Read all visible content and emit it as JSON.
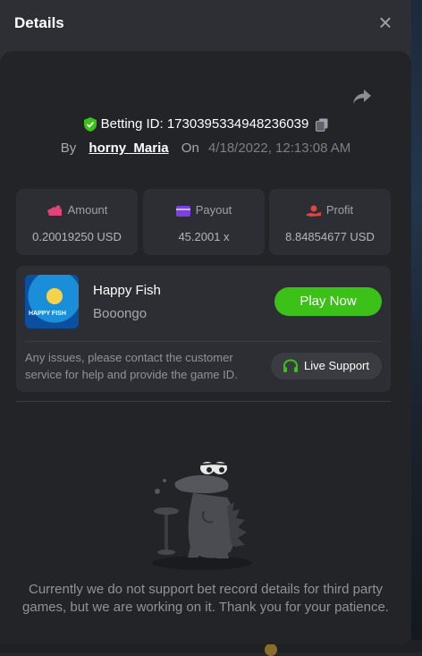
{
  "modal": {
    "title": "Details"
  },
  "bet": {
    "betting_id_label": "Betting ID: 1730395334948236039",
    "by_label": "By",
    "username": "horny_Maria",
    "on_label": "On",
    "date": "4/18/2022, 12:13:08 AM"
  },
  "stats": {
    "amount": {
      "label": "Amount",
      "value": "0.20019250 USD",
      "icon": "amount-icon",
      "color": "#e0447a"
    },
    "payout": {
      "label": "Payout",
      "value": "45.2001 x",
      "icon": "card-icon",
      "color": "#7b3fe4"
    },
    "profit": {
      "label": "Profit",
      "value": "8.84854677 USD",
      "icon": "hand-coin-icon",
      "color": "#e04545"
    }
  },
  "game": {
    "name": "Happy Fish",
    "provider": "Booongo",
    "thumb_text": "HAPPY FISH",
    "play_label": "Play Now",
    "support_text": "Any issues, please contact the customer service for help and provide the game ID.",
    "support_label": "Live Support"
  },
  "notice": "Currently we do not support bet record details for third party games, but we are working on it. Thank you for your patience.",
  "colors": {
    "accent": "#3bc117",
    "verified": "#3bc117"
  }
}
